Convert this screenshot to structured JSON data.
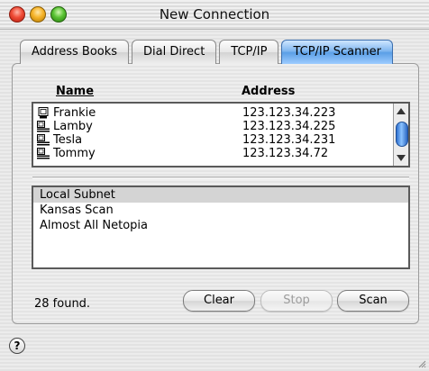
{
  "window": {
    "title": "New Connection"
  },
  "tabs": [
    {
      "label": "Address Books",
      "selected": false
    },
    {
      "label": "Dial Direct",
      "selected": false
    },
    {
      "label": "TCP/IP",
      "selected": false
    },
    {
      "label": "TCP/IP Scanner",
      "selected": true
    }
  ],
  "results": {
    "columns": {
      "name": "Name",
      "address": "Address"
    },
    "rows": [
      {
        "name": "Frankie",
        "address": "123.123.34.223",
        "icon": "single-computer-icon"
      },
      {
        "name": "Lamby",
        "address": "123.123.34.225",
        "icon": "networked-computer-icon"
      },
      {
        "name": "Tesla",
        "address": "123.123.34.231",
        "icon": "networked-computer-icon"
      },
      {
        "name": "Tommy",
        "address": "123.123.34.72",
        "icon": "networked-computer-icon"
      }
    ]
  },
  "scan_sets": {
    "items": [
      {
        "label": "Local Subnet",
        "selected": true
      },
      {
        "label": "Kansas Scan",
        "selected": false
      },
      {
        "label": "Almost All Netopia",
        "selected": false
      }
    ]
  },
  "status": {
    "text": "28 found."
  },
  "buttons": {
    "clear": "Clear",
    "stop": "Stop",
    "scan": "Scan"
  },
  "help": {
    "symbol": "?"
  },
  "colors": {
    "selected_tab": "#5b9fe6",
    "scroll_thumb": "#2d6fd0"
  }
}
